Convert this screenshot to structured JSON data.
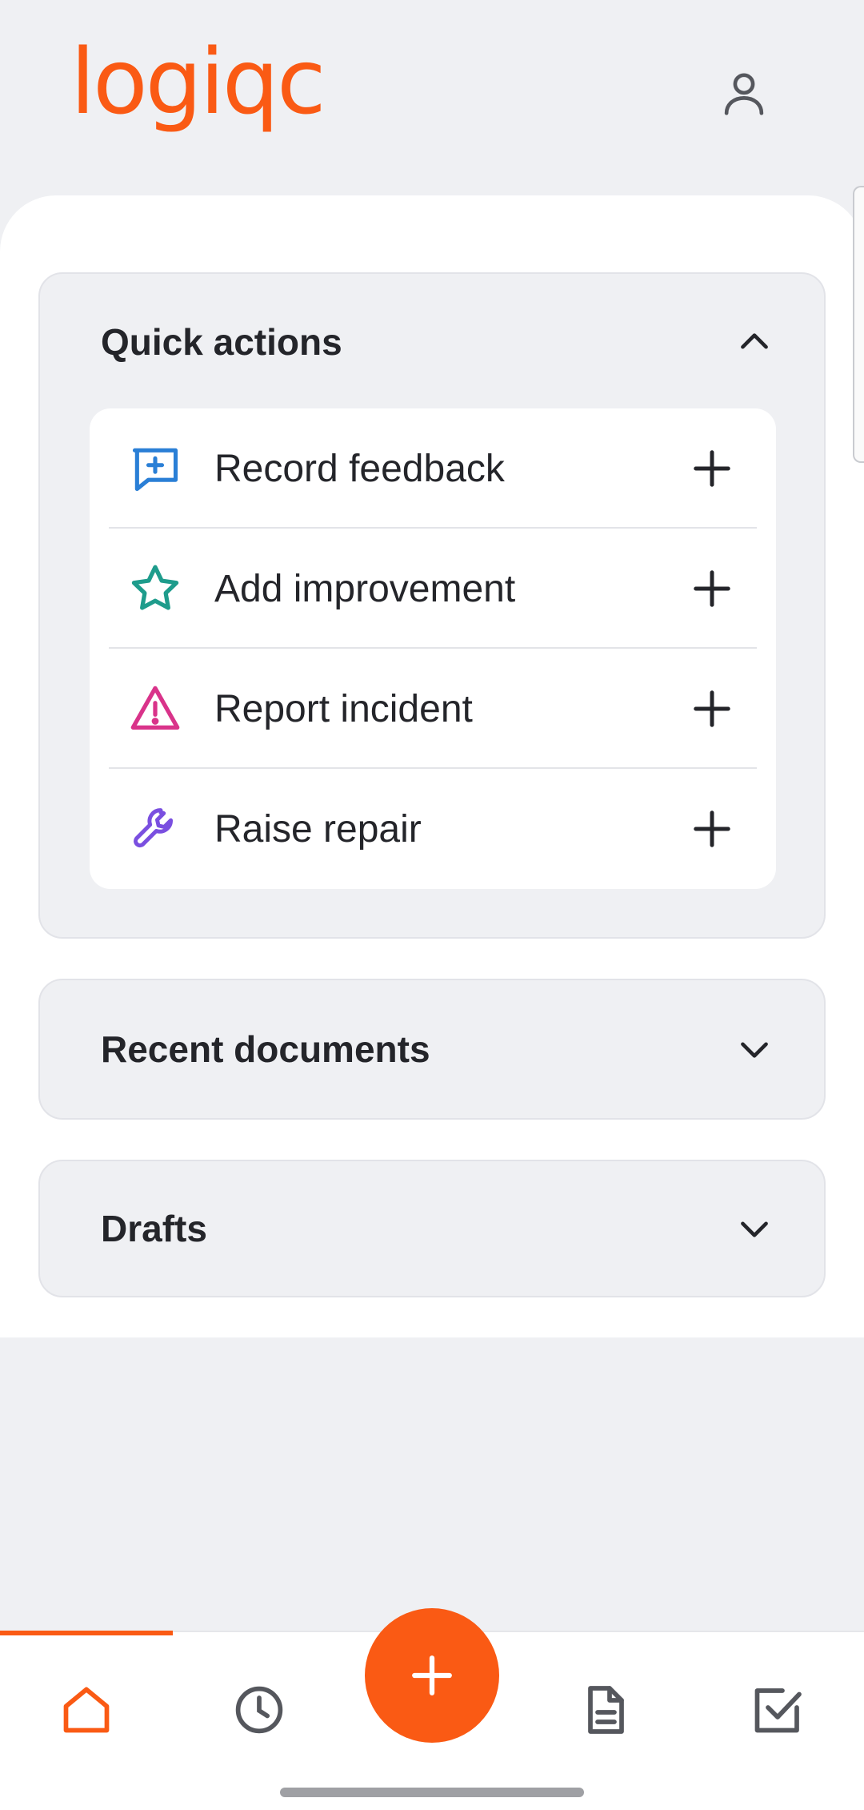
{
  "header": {
    "logo_text": "logiqc"
  },
  "quick_actions": {
    "title": "Quick actions",
    "items": [
      {
        "label": "Record feedback",
        "icon": "message-plus-icon",
        "icon_color": "#2a7fd6"
      },
      {
        "label": "Add improvement",
        "icon": "star-icon",
        "icon_color": "#1e9c8c"
      },
      {
        "label": "Report incident",
        "icon": "warning-icon",
        "icon_color": "#d9338a"
      },
      {
        "label": "Raise repair",
        "icon": "wrench-icon",
        "icon_color": "#7a4fe0"
      }
    ]
  },
  "recent_documents": {
    "title": "Recent documents"
  },
  "drafts": {
    "title": "Drafts"
  },
  "nav": {
    "items": [
      "home-icon",
      "clock-icon",
      "add-icon",
      "document-icon",
      "checkbox-icon"
    ],
    "active": "home"
  },
  "colors": {
    "brand": "#fa5a14",
    "background": "#eff0f3",
    "text": "#24252a"
  }
}
